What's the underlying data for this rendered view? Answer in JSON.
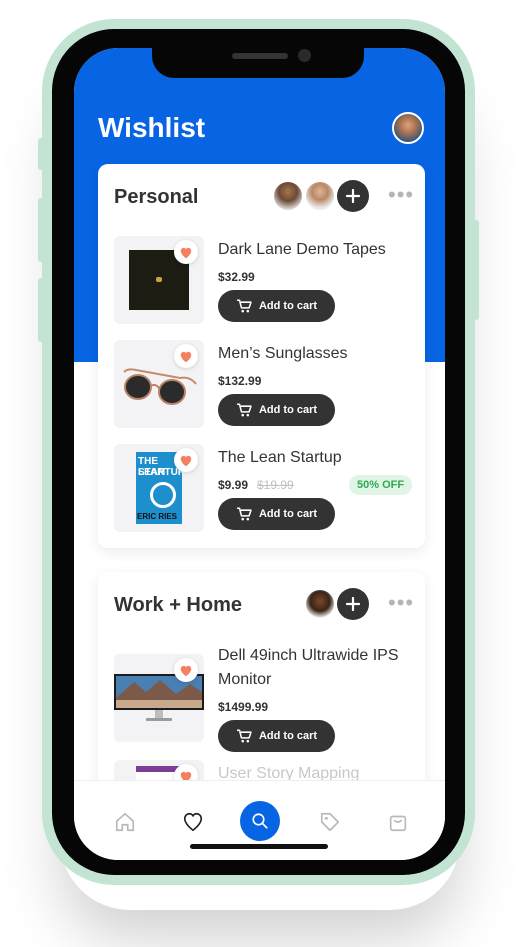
{
  "header": {
    "title": "Wishlist"
  },
  "lists": [
    {
      "title": "Personal",
      "items": [
        {
          "name": "Dark Lane Demo Tapes",
          "price": "$32.99",
          "cta": "Add to cart"
        },
        {
          "name": "Men’s Sunglasses",
          "price": "$132.99",
          "cta": "Add to cart"
        },
        {
          "name": "The Lean Startup",
          "price": "$9.99",
          "old_price": "$19.99",
          "badge": "50% OFF",
          "cta": "Add to cart",
          "cover_title_1": "THE LEAN",
          "cover_title_2": "STARTUP",
          "cover_author": "ERIC RIES"
        }
      ]
    },
    {
      "title": "Work + Home",
      "items": [
        {
          "name_line1": "Dell 49inch Ultrawide IPS",
          "name_line2": "Monitor",
          "price": "$1499.99",
          "cta": "Add to cart"
        },
        {
          "name": "User Story Mapping"
        }
      ]
    }
  ],
  "nav": {
    "items": [
      "home-icon",
      "heart-icon",
      "search-icon",
      "tag-icon",
      "bag-icon"
    ],
    "active": "heart-icon"
  },
  "colors": {
    "primary": "#0764e3",
    "dark": "#333333",
    "heart": "#f4805e",
    "badge_text": "#2eaa4f",
    "frame": "#c3e4d3"
  }
}
